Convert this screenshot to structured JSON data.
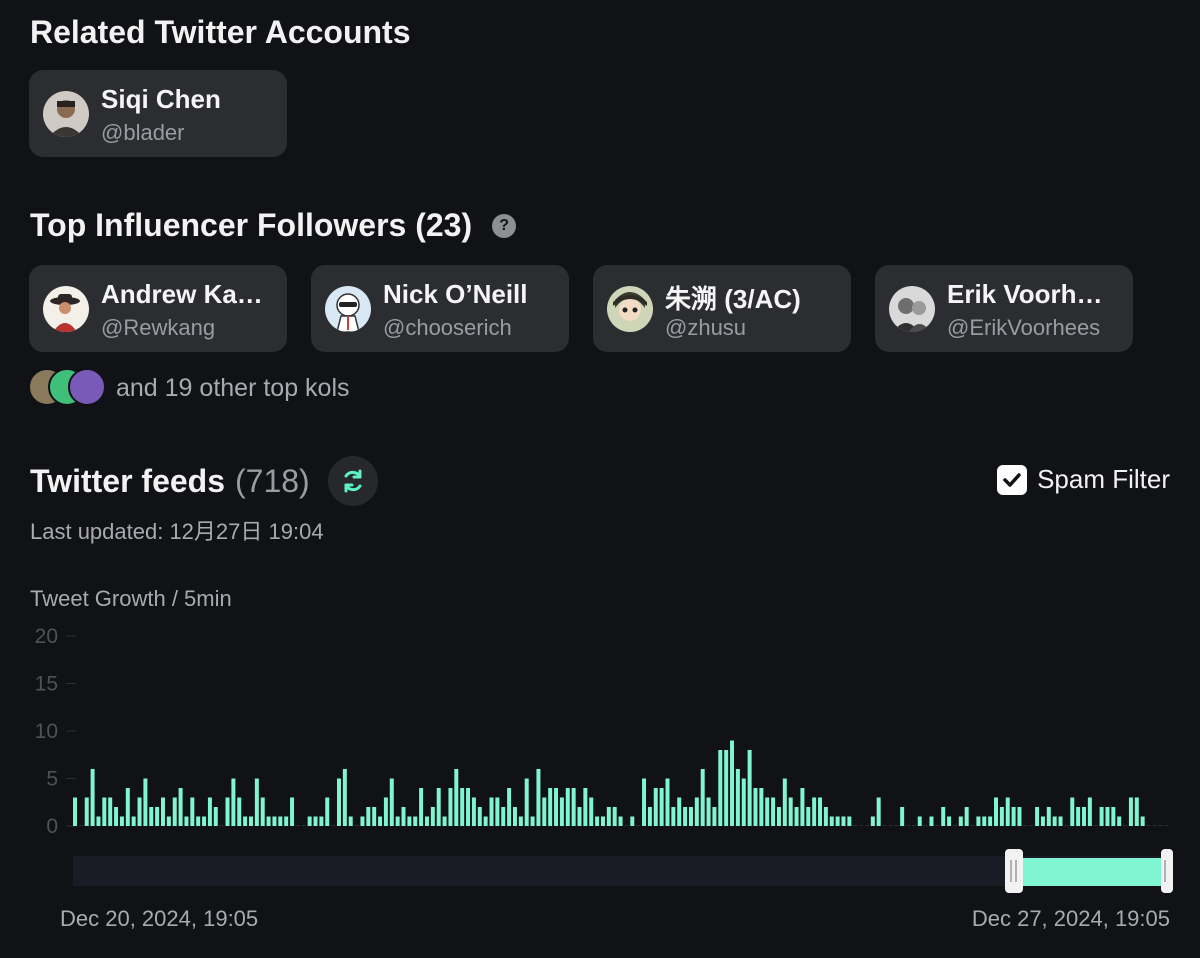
{
  "related": {
    "title": "Related Twitter Accounts",
    "account": {
      "name": "Siqi Chen",
      "handle": "@blader",
      "avatar": "person-avatar-icon"
    }
  },
  "influencers": {
    "title": "Top Influencer Followers (23)",
    "help_icon": "question-mark-icon",
    "cards": [
      {
        "name": "Andrew Ka…",
        "handle": "@Rewkang",
        "avatar": "hat-avatar-icon",
        "avatar_bg": "#f3f0ea"
      },
      {
        "name": "Nick O’Neill",
        "handle": "@chooserich",
        "avatar": "cartoon-avatar-icon",
        "avatar_bg": "#d8e8f5"
      },
      {
        "name": "朱溯 (3/AC)",
        "handle": "@zhusu",
        "avatar": "anime-avatar-icon",
        "avatar_bg": "#cfd6b8"
      },
      {
        "name": "Erik Voorh…",
        "handle": "@ErikVoorhees",
        "avatar": "photo-avatar-icon",
        "avatar_bg": "#d9d9d9"
      }
    ],
    "others_text": "and 19 other top kols",
    "others_avatars": [
      "#8a7a5c",
      "#3fbf7a",
      "#7a5ab8"
    ]
  },
  "feeds": {
    "title": "Twitter feeds",
    "count": "(718)",
    "refresh_icon": "refresh-icon",
    "spam_filter_label": "Spam Filter",
    "spam_filter_checked": true,
    "last_updated": "Last updated: 12月27日 19:04"
  },
  "chart_data": {
    "type": "bar",
    "title": "Tweet Growth / 5min",
    "ylim": [
      0,
      20
    ],
    "y_ticks": [
      "20",
      "15",
      "10",
      "5",
      "0"
    ],
    "bar_color": "#7ff5d2",
    "values": [
      3,
      0,
      3,
      6,
      1,
      3,
      3,
      2,
      1,
      4,
      1,
      3,
      5,
      2,
      2,
      3,
      1,
      3,
      4,
      1,
      3,
      1,
      1,
      3,
      2,
      0,
      3,
      5,
      3,
      1,
      1,
      5,
      3,
      1,
      1,
      1,
      1,
      3,
      0,
      0,
      1,
      1,
      1,
      3,
      0,
      5,
      6,
      1,
      0,
      1,
      2,
      2,
      1,
      3,
      5,
      1,
      2,
      1,
      1,
      4,
      1,
      2,
      4,
      1,
      4,
      6,
      4,
      4,
      3,
      2,
      1,
      3,
      3,
      2,
      4,
      2,
      1,
      5,
      1,
      6,
      3,
      4,
      4,
      3,
      4,
      4,
      2,
      4,
      3,
      1,
      1,
      2,
      2,
      1,
      0,
      1,
      0,
      5,
      2,
      4,
      4,
      5,
      2,
      3,
      2,
      2,
      3,
      6,
      3,
      2,
      8,
      8,
      9,
      6,
      5,
      8,
      4,
      4,
      3,
      3,
      2,
      5,
      3,
      2,
      4,
      2,
      3,
      3,
      2,
      1,
      1,
      1,
      1,
      0,
      0,
      0,
      1,
      3,
      0,
      0,
      0,
      2,
      0,
      0,
      1,
      0,
      1,
      0,
      2,
      1,
      0,
      1,
      2,
      0,
      1,
      1,
      1,
      3,
      2,
      3,
      2,
      2,
      0,
      0,
      2,
      1,
      2,
      1,
      1,
      0,
      3,
      2,
      2,
      3,
      0,
      2,
      2,
      2,
      1,
      0,
      3,
      3,
      1,
      0,
      0,
      0,
      0
    ],
    "range_start": "Dec 20, 2024, 19:05",
    "range_end": "Dec 27, 2024, 19:05",
    "zoom_fill_color": "#7ff5d2"
  }
}
